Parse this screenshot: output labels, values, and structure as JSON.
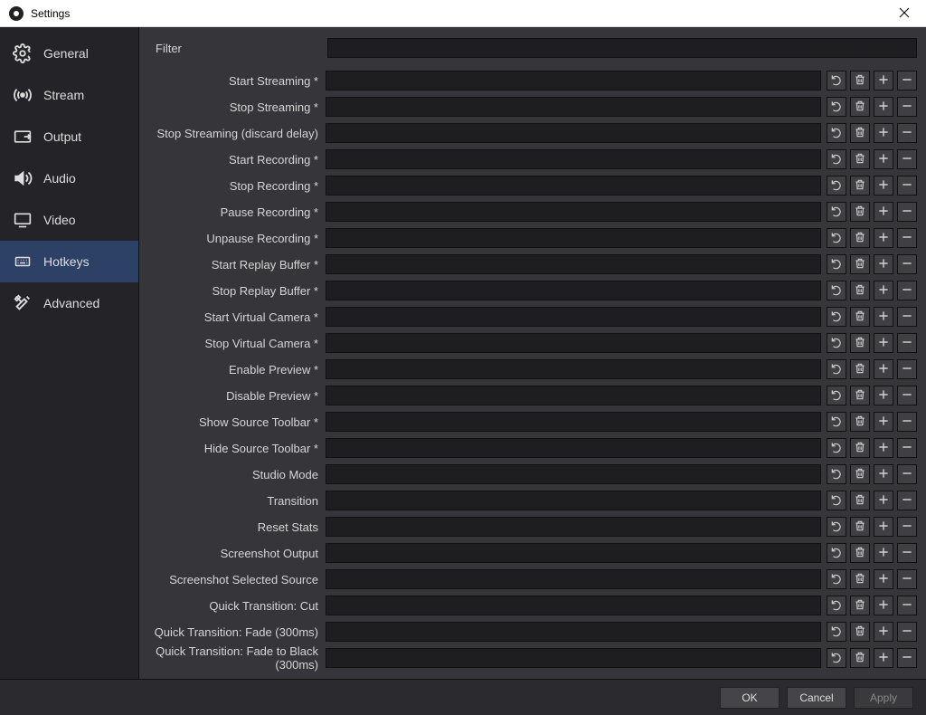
{
  "titlebar": {
    "title": "Settings"
  },
  "sidebar": {
    "items": [
      {
        "label": "General"
      },
      {
        "label": "Stream"
      },
      {
        "label": "Output"
      },
      {
        "label": "Audio"
      },
      {
        "label": "Video"
      },
      {
        "label": "Hotkeys"
      },
      {
        "label": "Advanced"
      }
    ],
    "active_index": 5
  },
  "main": {
    "filter_label": "Filter",
    "filter_value": "",
    "hotkeys": [
      {
        "label": "Start Streaming *"
      },
      {
        "label": "Stop Streaming *"
      },
      {
        "label": "Stop Streaming (discard delay)"
      },
      {
        "label": "Start Recording *"
      },
      {
        "label": "Stop Recording *"
      },
      {
        "label": "Pause Recording *"
      },
      {
        "label": "Unpause Recording *"
      },
      {
        "label": "Start Replay Buffer *"
      },
      {
        "label": "Stop Replay Buffer *"
      },
      {
        "label": "Start Virtual Camera *"
      },
      {
        "label": "Stop Virtual Camera *"
      },
      {
        "label": "Enable Preview *"
      },
      {
        "label": "Disable Preview *"
      },
      {
        "label": "Show Source Toolbar *"
      },
      {
        "label": "Hide Source Toolbar *"
      },
      {
        "label": "Studio Mode"
      },
      {
        "label": "Transition"
      },
      {
        "label": "Reset Stats"
      },
      {
        "label": "Screenshot Output"
      },
      {
        "label": "Screenshot Selected Source"
      },
      {
        "label": "Quick Transition: Cut"
      },
      {
        "label": "Quick Transition: Fade (300ms)"
      },
      {
        "label": "Quick Transition: Fade to Black (300ms)"
      }
    ]
  },
  "bottombar": {
    "ok": "OK",
    "cancel": "Cancel",
    "apply": "Apply"
  }
}
